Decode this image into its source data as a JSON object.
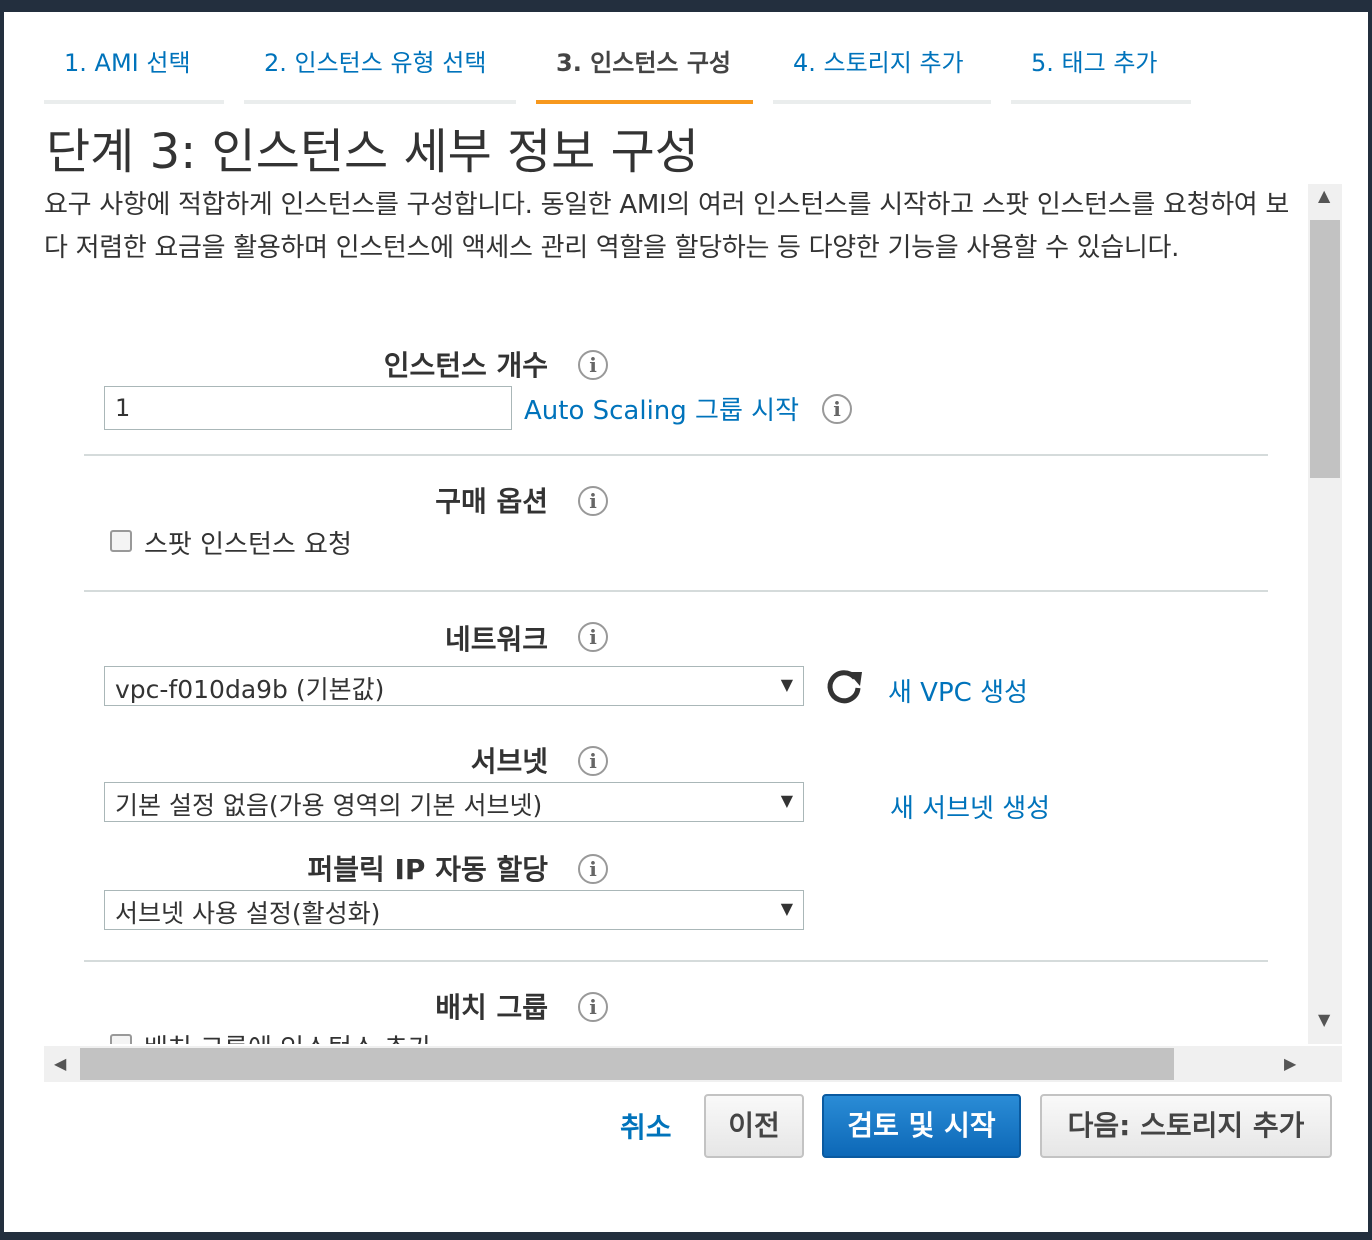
{
  "wizard": {
    "tabs": [
      {
        "label": "1. AMI 선택",
        "active": false
      },
      {
        "label": "2. 인스턴스 유형 선택",
        "active": false
      },
      {
        "label": "3. 인스턴스 구성",
        "active": true
      },
      {
        "label": "4. 스토리지 추가",
        "active": false
      },
      {
        "label": "5. 태그 추가",
        "active": false
      }
    ],
    "title": "단계 3: 인스턴스 세부 정보 구성",
    "description": "요구 사항에 적합하게 인스턴스를 구성합니다. 동일한 AMI의 여러 인스턴스를 시작하고 스팟 인스턴스를 요청하여 보다 저렴한 요금을 활용하며 인스턴스에 액세스 관리 역할을 할당하는 등 다양한 기능을 사용할 수 있습니다."
  },
  "form": {
    "instance_count": {
      "label": "인스턴스 개수",
      "value": "1",
      "autoscaling_link": "Auto Scaling 그룹 시작"
    },
    "purchase_option": {
      "label": "구매 옵션",
      "spot_checkbox_label": "스팟 인스턴스 요청",
      "checked": false
    },
    "network": {
      "label": "네트워크",
      "selected": "vpc-f010da9b (기본값)",
      "create_link": "새 VPC 생성"
    },
    "subnet": {
      "label": "서브넷",
      "selected": "기본 설정 없음(가용 영역의 기본 서브넷)",
      "create_link": "새 서브넷 생성"
    },
    "public_ip": {
      "label": "퍼블릭 IP 자동 할당",
      "selected": "서브넷 사용 설정(활성화)"
    },
    "placement_group": {
      "label": "배치 그룹",
      "checkbox_label": "배치 그룹에 인스턴스 추가",
      "checked": false
    }
  },
  "footer": {
    "cancel": "취소",
    "previous": "이전",
    "review_launch": "검토 및 시작",
    "next": "다음: 스토리지 추가"
  },
  "icons": {
    "info": "info-icon",
    "refresh": "refresh-icon",
    "select_arrow": "▼"
  },
  "colors": {
    "link": "#0073bb",
    "active_tab_underline": "#f7981d",
    "primary_button": "#1a73c8"
  }
}
